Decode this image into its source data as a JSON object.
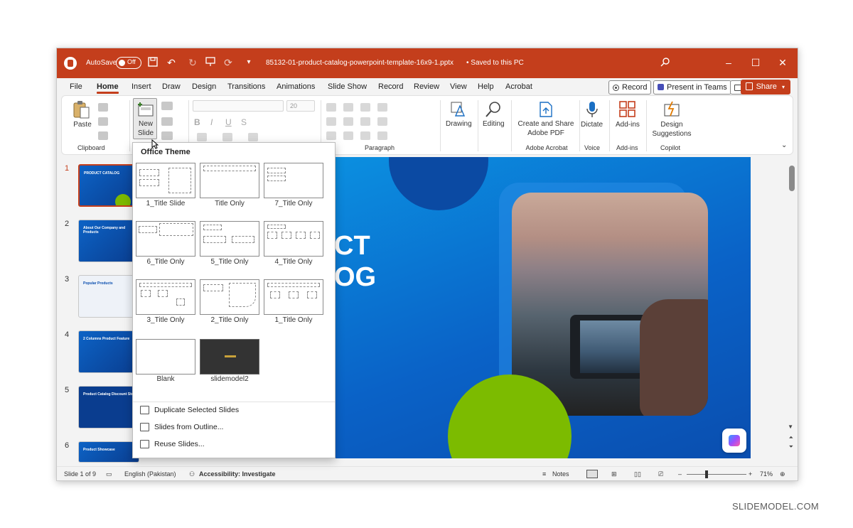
{
  "titlebar": {
    "autosave_label": "AutoSave",
    "autosave_state": "Off",
    "filename": "85132-01-product-catalog-powerpoint-template-16x9-1.pptx",
    "saved_status": "• Saved to this PC",
    "bg_color": "#c43e1c"
  },
  "tabs": [
    "File",
    "Home",
    "Insert",
    "Draw",
    "Design",
    "Transitions",
    "Animations",
    "Slide Show",
    "Record",
    "Review",
    "View",
    "Help",
    "Acrobat"
  ],
  "tab_active": "Home",
  "topbuttons": {
    "record": "Record",
    "present_teams": "Present in Teams",
    "share": "Share"
  },
  "ribbon": {
    "paste": "Paste",
    "clipboard": "Clipboard",
    "new_slide_line1": "New",
    "new_slide_line2": "Slide",
    "font_size": "20",
    "paragraph": "Paragraph",
    "drawing": "Drawing",
    "editing": "Editing",
    "create_share_line1": "Create and Share",
    "create_share_line2": "Adobe PDF",
    "adobe_acrobat": "Adobe Acrobat",
    "dictate": "Dictate",
    "voice": "Voice",
    "addins": "Add-ins",
    "addins_group": "Add-ins",
    "design_line1": "Design",
    "design_line2": "Suggestions",
    "copilot": "Copilot"
  },
  "thumbnails": [
    {
      "num": "1",
      "text": "PRODUCT CATALOG"
    },
    {
      "num": "2",
      "text": "About Our Company and Products"
    },
    {
      "num": "3",
      "text": "Popular Products"
    },
    {
      "num": "4",
      "text": "2 Columns Product Feature"
    },
    {
      "num": "5",
      "text": "Product Catalog Discount Store"
    },
    {
      "num": "6",
      "text": "Product Showcase"
    }
  ],
  "slide_visible_text": {
    "line1": "CT",
    "line2": "OG"
  },
  "dropdown": {
    "title": "Office Theme",
    "layouts": [
      "1_Title Slide",
      "Title Only",
      "7_Title Only",
      "6_Title Only",
      "5_Title Only",
      "4_Title Only",
      "3_Title Only",
      "2_Title Only",
      "1_Title Only",
      "Blank",
      "slidemodel2"
    ],
    "actions": [
      "Duplicate Selected Slides",
      "Slides from Outline...",
      "Reuse Slides..."
    ]
  },
  "statusbar": {
    "slide_info": "Slide 1 of 9",
    "language": "English (Pakistan)",
    "accessibility": "Accessibility: Investigate",
    "notes": "Notes",
    "zoom": "71%"
  },
  "brand": "SLIDEMODEL.COM"
}
